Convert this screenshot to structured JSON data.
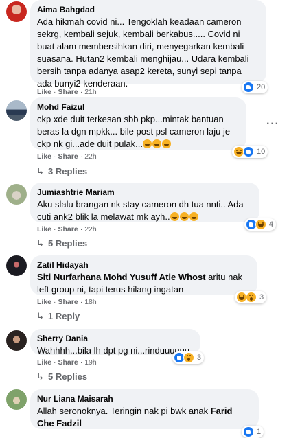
{
  "comments": [
    {
      "author": "Aima Bahgdad",
      "text": "Ada hikmah covid ni... Tengoklah keadaan cameron sekrg, kembali sejuk, kembali berkabus..... Covid ni buat alam membersihkan diri, menyegarkan kembali suasana. Hutan2 kembali menghijau... Udara kembali bersih tanpa adanya asap2 kereta, sunyi sepi tanpa ada bunyi2 kenderaan.",
      "like": "Like",
      "share": "Share",
      "time": "21h",
      "reactions": [
        "like"
      ],
      "reaction_count": "20"
    },
    {
      "author": "Mohd Faizul",
      "text": "ckp xde duit terkesan sbb pkp...mintak bantuan beras la dgn mpkk... bile post psl cameron laju je ckp nk gi...ade duit pulak...",
      "emojis": [
        "haha-emoji",
        "haha-emoji",
        "haha-emoji"
      ],
      "like": "Like",
      "share": "Share",
      "time": "22h",
      "reactions": [
        "haha",
        "like"
      ],
      "reaction_count": "10",
      "replies": "3 Replies",
      "more": "···"
    },
    {
      "author": "Jumiashtrie Mariam",
      "text": "Aku slalu brangan nk stay cameron dh tua nnti.. Ada cuti ank2 blik la melawat mk ayh..",
      "emojis": [
        "laugh-emoji",
        "laugh-emoji",
        "laugh-emoji"
      ],
      "like": "Like",
      "share": "Share",
      "time": "22h",
      "reactions": [
        "like",
        "haha"
      ],
      "reaction_count": "4",
      "replies": "5 Replies"
    },
    {
      "author": "Zatil Hidayah",
      "mention": "Siti Nurfarhana Mohd Yusuff Atie Whost",
      "text": " aritu nak left group ni, tapi terus hilang ingatan",
      "like": "Like",
      "share": "Share",
      "time": "18h",
      "reactions": [
        "haha",
        "wow"
      ],
      "reaction_count": "3",
      "replies": "1 Reply"
    },
    {
      "author": "Sherry Dania",
      "text": "Wahhhh...bila lh dpt pg ni...rinduuuuuu",
      "like": "Like",
      "share": "Share",
      "time": "19h",
      "reactions": [
        "like",
        "wow"
      ],
      "reaction_count": "3",
      "replies": "5 Replies"
    },
    {
      "author": "Nur Liana Maisarah",
      "text": "Allah seronoknya. Teringin nak pi bwk anak ",
      "mention": "Farid Che Fadzil",
      "reactions": [
        "like"
      ],
      "reaction_count": "1"
    }
  ],
  "separator": "·",
  "colors": {
    "bubble": "#f0f2f5",
    "meta": "#65676b",
    "like_blue": "#1877f2",
    "haha_yellow": "#f7b125"
  }
}
